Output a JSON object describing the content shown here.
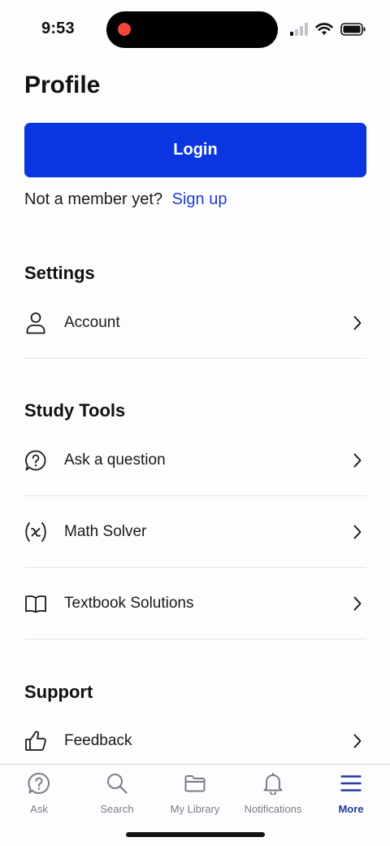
{
  "status_bar": {
    "time": "9:53"
  },
  "page": {
    "title": "Profile"
  },
  "login": {
    "button_label": "Login"
  },
  "signup": {
    "prompt": "Not a member yet?",
    "link": "Sign up"
  },
  "sections": {
    "settings": {
      "title": "Settings",
      "items": [
        {
          "label": "Account",
          "icon": "person-icon"
        }
      ]
    },
    "study_tools": {
      "title": "Study Tools",
      "items": [
        {
          "label": "Ask a question",
          "icon": "question-bubble-icon"
        },
        {
          "label": "Math Solver",
          "icon": "math-x-icon"
        },
        {
          "label": "Textbook Solutions",
          "icon": "book-icon"
        }
      ]
    },
    "support": {
      "title": "Support",
      "items": [
        {
          "label": "Feedback",
          "icon": "thumbs-up-icon"
        }
      ]
    }
  },
  "tab_bar": {
    "tabs": [
      {
        "label": "Ask",
        "icon": "question-circle-icon"
      },
      {
        "label": "Search",
        "icon": "search-icon"
      },
      {
        "label": "My Library",
        "icon": "folder-icon"
      },
      {
        "label": "Notifications",
        "icon": "bell-icon"
      },
      {
        "label": "More",
        "icon": "menu-icon",
        "active": true
      }
    ]
  },
  "colors": {
    "primary": "#0a35e0",
    "link": "#1e3fc9",
    "active_tab": "#1e3a9f",
    "recording": "#f2453a"
  }
}
